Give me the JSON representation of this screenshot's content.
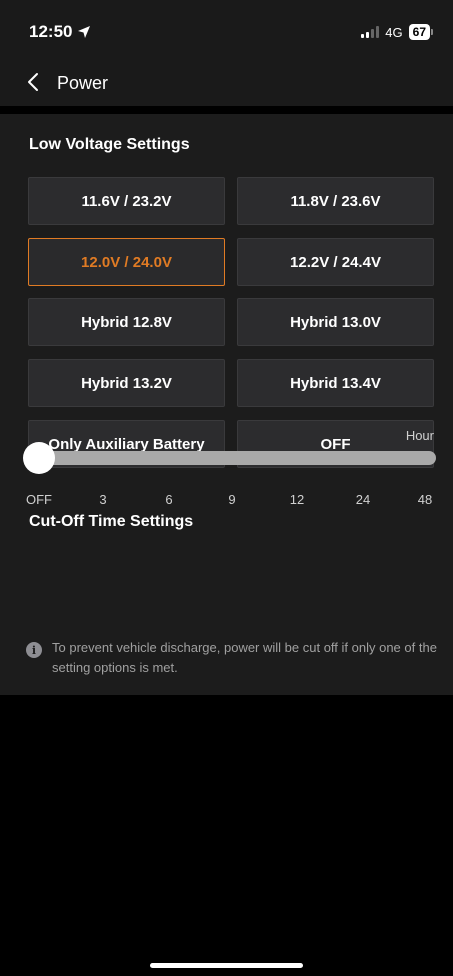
{
  "status_bar": {
    "time": "12:50",
    "network": "4G",
    "battery": "67"
  },
  "nav": {
    "title": "Power"
  },
  "low_voltage": {
    "title": "Low Voltage Settings",
    "options": [
      {
        "label": "11.6V / 23.2V",
        "selected": false
      },
      {
        "label": "11.8V / 23.6V",
        "selected": false
      },
      {
        "label": "12.0V / 24.0V",
        "selected": true
      },
      {
        "label": "12.2V / 24.4V",
        "selected": false
      },
      {
        "label": "Hybrid 12.8V",
        "selected": false
      },
      {
        "label": "Hybrid 13.0V",
        "selected": false
      },
      {
        "label": "Hybrid 13.2V",
        "selected": false
      },
      {
        "label": "Hybrid 13.4V",
        "selected": false
      },
      {
        "label": "Only Auxiliary Battery",
        "selected": false
      },
      {
        "label": "OFF",
        "selected": false
      }
    ]
  },
  "cutoff": {
    "title": "Cut-Off Time Settings",
    "unit": "Hour",
    "ticks": [
      "OFF",
      "3",
      "6",
      "9",
      "12",
      "24",
      "48"
    ],
    "selected_value": "OFF",
    "info": "To prevent vehicle discharge, power will be cut off if only one of the setting options is met."
  },
  "colors": {
    "accent": "#e07b24",
    "panel": "#1c1c1c",
    "button": "#2c2c2e",
    "track": "#a9a9a9"
  },
  "icons": {
    "back": "chevron-left-icon",
    "location": "location-arrow-icon",
    "info": "info-icon"
  }
}
